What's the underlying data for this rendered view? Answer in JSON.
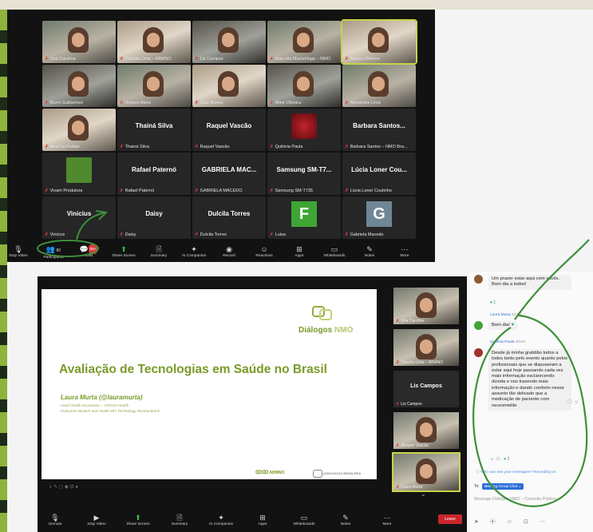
{
  "top_meeting": {
    "tiles": [
      {
        "name": "Jina Carolina",
        "muted": true,
        "kind": "video"
      },
      {
        "name": "Claudia Lima – ABMNO",
        "muted": true,
        "kind": "video"
      },
      {
        "name": "Lis Campos",
        "muted": true,
        "kind": "video"
      },
      {
        "name": "Marcella Maciel/Iaga – NMO",
        "muted": true,
        "kind": "video"
      },
      {
        "name": "Bianca Oliveira",
        "muted": true,
        "kind": "video",
        "active": true
      },
      {
        "name": "Burro Guillarmes",
        "muted": true,
        "kind": "video"
      },
      {
        "name": "Viviane Alves",
        "muted": true,
        "kind": "video"
      },
      {
        "name": "Caio Nunes",
        "muted": true,
        "kind": "video"
      },
      {
        "name": "Aline Oliveira",
        "muted": true,
        "kind": "video"
      },
      {
        "name": "Alexandre Lima",
        "muted": true,
        "kind": "video"
      },
      {
        "name": "Ana Lia Freitas",
        "muted": true,
        "kind": "video"
      },
      {
        "name": "Thainá Silva",
        "display": "Thainá Silva",
        "muted": true,
        "kind": "name"
      },
      {
        "name": "Raquel Vascão",
        "display": "Raquel Vascão",
        "muted": true,
        "kind": "name"
      },
      {
        "name": "Quitéria Paula",
        "muted": true,
        "kind": "image"
      },
      {
        "name": "Barbara Santos – NMO Bra...",
        "display": "Barbara Santos...",
        "muted": true,
        "kind": "name"
      },
      {
        "name": "Vivam Produtora",
        "muted": true,
        "kind": "logo"
      },
      {
        "name": "Rafael Paternó",
        "display": "Rafael Paternó",
        "muted": true,
        "kind": "name"
      },
      {
        "name": "GABRIELA MACEDO",
        "display": "GABRIELA MAC...",
        "muted": true,
        "kind": "name"
      },
      {
        "name": "Samsung SM-T735",
        "display": "Samsung SM-T7...",
        "muted": true,
        "kind": "name"
      },
      {
        "name": "Lúcia Loner Coutinho",
        "display": "Lúcia Loner Cou...",
        "muted": true,
        "kind": "name"
      },
      {
        "name": "Vinicius",
        "display": "Vinicius",
        "muted": true,
        "kind": "name"
      },
      {
        "name": "Daisy",
        "display": "Daisy",
        "muted": true,
        "kind": "name"
      },
      {
        "name": "Dulcila Torres",
        "display": "Dulcila Torres",
        "muted": true,
        "kind": "name"
      },
      {
        "name": "Luisa",
        "letter": "F",
        "muted": true,
        "kind": "letter",
        "color": "#3fa535"
      },
      {
        "name": "Gabriela Macedo",
        "letter": "G",
        "muted": true,
        "kind": "letter",
        "color": "#6f8796"
      }
    ],
    "toolbar": [
      {
        "icon": "mic",
        "label": "Stop Video"
      },
      {
        "icon": "people",
        "label": "Participants",
        "count": "80"
      },
      {
        "icon": "chat",
        "label": "Chat",
        "badge": "99+"
      },
      {
        "icon": "share",
        "label": "Share Screen",
        "green": true
      },
      {
        "icon": "doc",
        "label": "Summary"
      },
      {
        "icon": "spark",
        "label": "AI Companion"
      },
      {
        "icon": "record",
        "label": "Record"
      },
      {
        "icon": "emoji",
        "label": "Reactions"
      },
      {
        "icon": "apps",
        "label": "Apps"
      },
      {
        "icon": "board",
        "label": "Whiteboards"
      },
      {
        "icon": "note",
        "label": "Notes"
      },
      {
        "icon": "more",
        "label": "More"
      }
    ]
  },
  "bottom_meeting": {
    "slide": {
      "title": "Avaliação de Tecnologias em Saúde no Brasil",
      "author": "Laura Murta (@lauramurta)",
      "roles": [
        "Head Health Economics – ORIGIN Health",
        "Podcaster Biotech and Health MIT Technology Review Brasil"
      ],
      "logo_main": "Diálogos",
      "logo_accent": "NMO",
      "sponsor1": "ABMNO",
      "sponsor2": "ASSOCIAÇÃO BRASILEIRA"
    },
    "participants": [
      {
        "name": "Jina Carolina",
        "kind": "video"
      },
      {
        "name": "Claudia Lima – ABMNO",
        "kind": "video"
      },
      {
        "name": "Lis Campos",
        "kind": "name",
        "display": "Lis Campos"
      },
      {
        "name": "Abeiper Vascão",
        "kind": "video"
      },
      {
        "name": "Laura Murta",
        "kind": "video",
        "active": true
      }
    ],
    "toolbar": [
      {
        "icon": "mic",
        "label": "Unmute"
      },
      {
        "icon": "video",
        "label": "Stop Video"
      },
      {
        "icon": "share",
        "label": "Share Screen",
        "green": true
      },
      {
        "icon": "doc",
        "label": "Summary"
      },
      {
        "icon": "spark",
        "label": "AI Companion"
      },
      {
        "icon": "apps",
        "label": "Apps"
      },
      {
        "icon": "board",
        "label": "Whiteboards"
      },
      {
        "icon": "note",
        "label": "Notes"
      },
      {
        "icon": "more",
        "label": "More"
      }
    ],
    "leave_label": "Leave"
  },
  "chat": {
    "messages": [
      {
        "text": "Um prazer estar aqui com vocês. Bom dia a todos!",
        "reaction": "1"
      },
      {
        "sender": "Laura Murta",
        "time": "10:00",
        "text": "Bom dia!"
      },
      {
        "sender": "Quitéria Paula",
        "time": "10:03",
        "text": "Desde já minha gratidão todos a todos tanto pelo evento quanto pelos profissionais que se dispuseram a estar aqui hoje passando cada vez mais informação esclarecendo dúvida e nos trazendo mais informação e dando conforto nesse assunto tão delicado que a medicação de paciente com neuromielite",
        "reaction": "2"
      }
    ],
    "hint": "Who can see your messages? Recording on",
    "to_label": "To:",
    "to_target": "Meeting Group Chat",
    "input_placeholder": "Message Diálogos NMO – Consulta Pública"
  },
  "colors": {
    "slide_green": "#7a9a2a",
    "zoom_dark": "#121212",
    "zoom_green": "#2ec24a",
    "annotation_green": "#3f8f3a",
    "leave_red": "#c9252c"
  }
}
